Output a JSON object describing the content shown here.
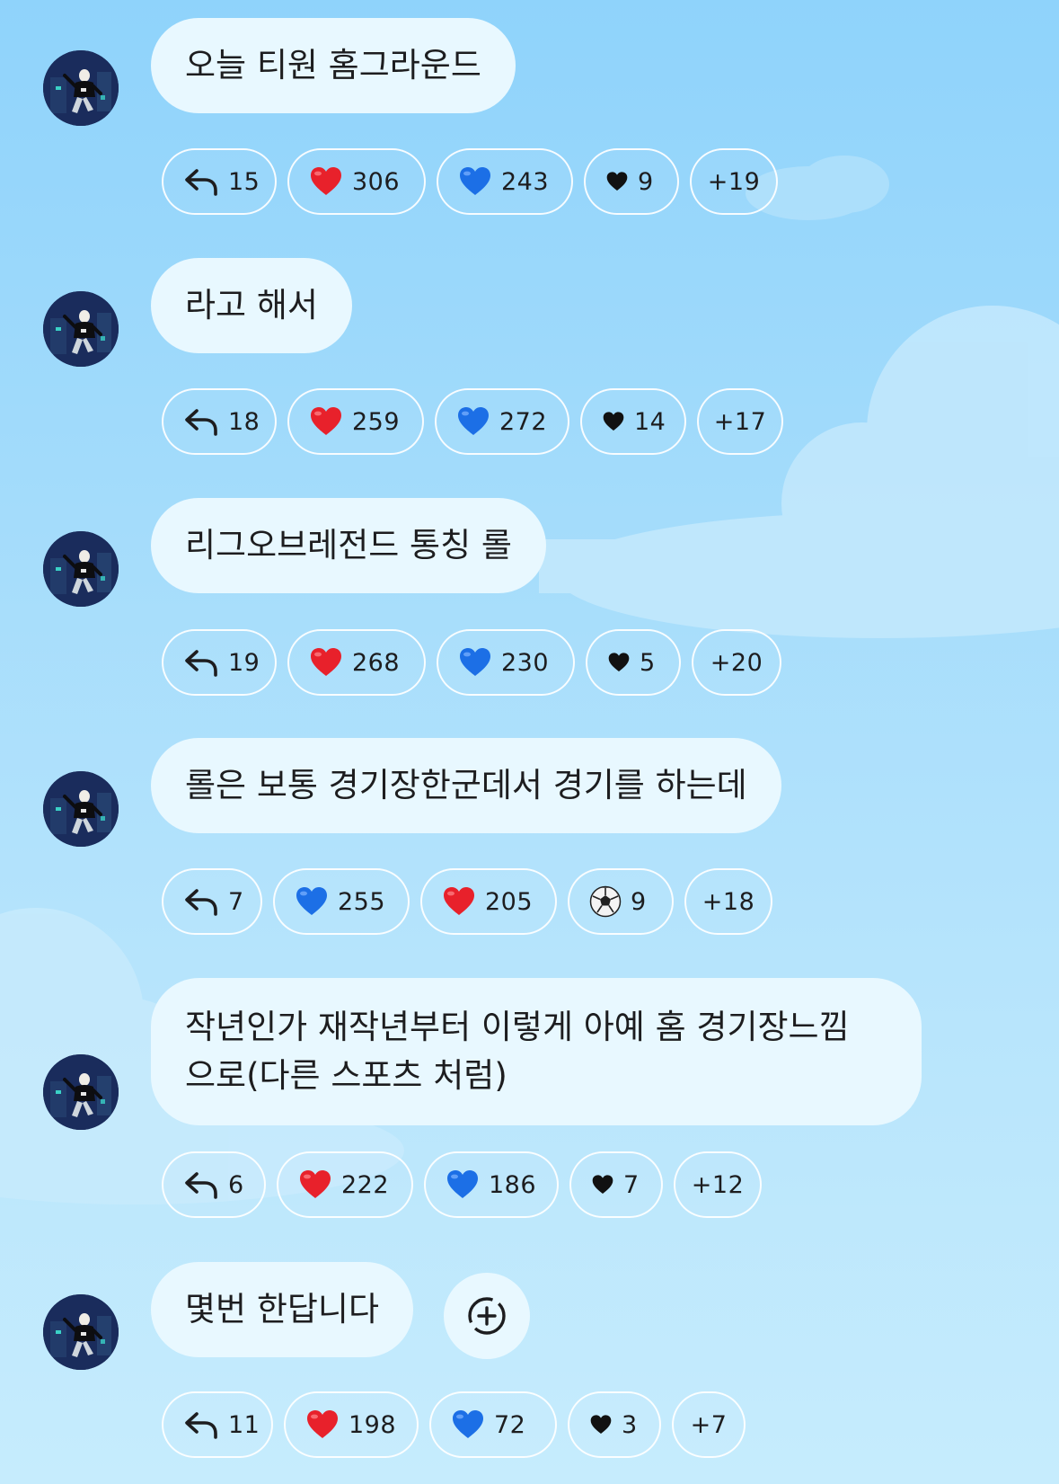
{
  "colors": {
    "bubble": "#e8f8ff",
    "chip_border": "#ffffff",
    "heart_red": "#e8212b",
    "heart_blue": "#1c6fe6",
    "heart_black": "#111111"
  },
  "messages": [
    {
      "text": "오늘 티원 홈그라운드",
      "reactions": [
        {
          "icon": "reply-icon",
          "count": "15"
        },
        {
          "icon": "red-heart-icon",
          "count": "306"
        },
        {
          "icon": "blue-heart-icon",
          "count": "243"
        },
        {
          "icon": "black-heart-icon",
          "count": "9"
        }
      ],
      "more": "+19"
    },
    {
      "text": "라고 해서",
      "reactions": [
        {
          "icon": "reply-icon",
          "count": "18"
        },
        {
          "icon": "red-heart-icon",
          "count": "259"
        },
        {
          "icon": "blue-heart-icon",
          "count": "272"
        },
        {
          "icon": "black-heart-icon",
          "count": "14"
        }
      ],
      "more": "+17"
    },
    {
      "text": "리그오브레전드 통칭 롤",
      "reactions": [
        {
          "icon": "reply-icon",
          "count": "19"
        },
        {
          "icon": "red-heart-icon",
          "count": "268"
        },
        {
          "icon": "blue-heart-icon",
          "count": "230"
        },
        {
          "icon": "black-heart-icon",
          "count": "5"
        }
      ],
      "more": "+20"
    },
    {
      "text": "롤은 보통 경기장한군데서 경기를 하는데",
      "reactions": [
        {
          "icon": "reply-icon",
          "count": "7"
        },
        {
          "icon": "blue-heart-icon",
          "count": "255"
        },
        {
          "icon": "red-heart-icon",
          "count": "205"
        },
        {
          "icon": "soccer-ball-icon",
          "count": "9"
        }
      ],
      "more": "+18"
    },
    {
      "text_lines": [
        "작년인가 재작년부터 이렇게 아예 홈 경기장느낌",
        "으로(다른 스포츠 처럼)"
      ],
      "reactions": [
        {
          "icon": "reply-icon",
          "count": "6"
        },
        {
          "icon": "red-heart-icon",
          "count": "222"
        },
        {
          "icon": "blue-heart-icon",
          "count": "186"
        },
        {
          "icon": "black-heart-icon",
          "count": "7"
        }
      ],
      "more": "+12"
    },
    {
      "text": "몇번 한답니다",
      "reactions": [
        {
          "icon": "reply-icon",
          "count": "11"
        },
        {
          "icon": "red-heart-icon",
          "count": "198"
        },
        {
          "icon": "blue-heart-icon",
          "count": "72"
        },
        {
          "icon": "black-heart-icon",
          "count": "3"
        }
      ],
      "more": "+7"
    }
  ]
}
